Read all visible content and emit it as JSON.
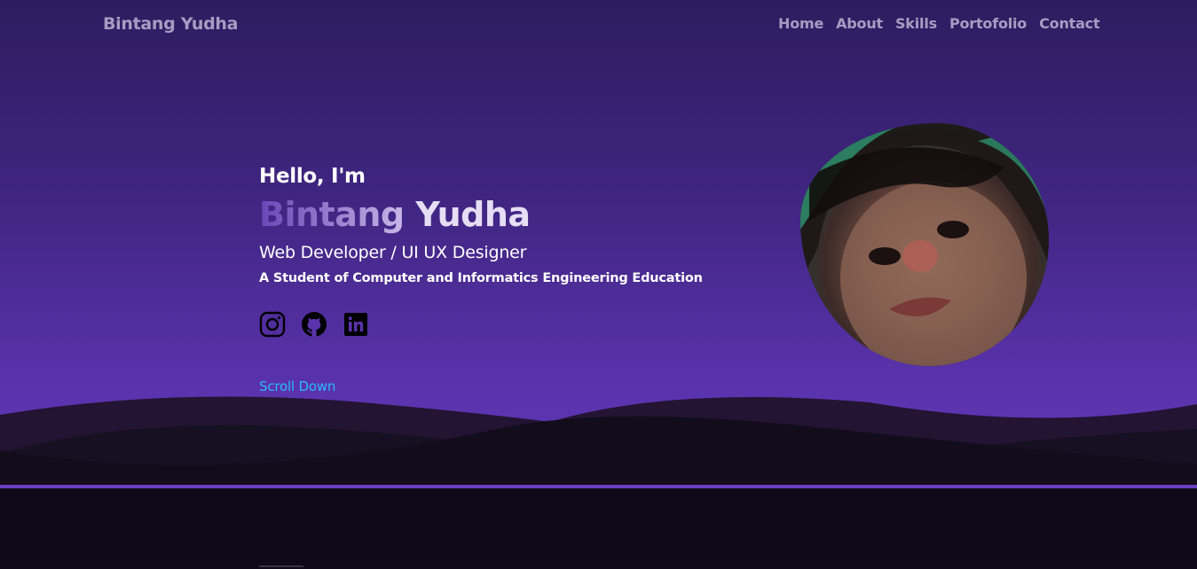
{
  "nav": {
    "logo": "Bintang Yudha",
    "items": [
      "Home",
      "About",
      "Skills",
      "Portofolio",
      "Contact"
    ]
  },
  "hero": {
    "greeting": "Hello, I'm",
    "first_name": "Bintang",
    "last_name": "Yudha",
    "role": "Web Developer / UI UX Designer",
    "tagline": "A Student of Computer and Informatics Engineering Education",
    "scroll_label": "Scroll Down"
  },
  "socials": {
    "icons": [
      "instagram-icon",
      "github-icon",
      "linkedin-icon"
    ]
  },
  "colors": {
    "background_dark": "#0f0a17",
    "hero_top": "#2f1c5f",
    "hero_bottom": "#5e35b4",
    "accent_stripe": "#6b3fc2",
    "scroll_link": "#2cb8ff"
  }
}
